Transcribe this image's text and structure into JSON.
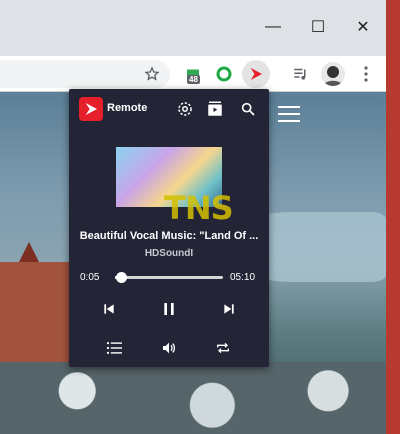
{
  "browser": {
    "window_controls": {
      "minimize": "—",
      "maximize": "☐",
      "close": "✕"
    },
    "extension_badge": "48"
  },
  "popup": {
    "app_name": "Remote",
    "track": {
      "title": "Beautiful Vocal Music: \"Land Of ...",
      "artist": "HDSoundI",
      "elapsed": "0:05",
      "duration": "05:10",
      "progress": 0.016
    },
    "watermark": "TNS"
  },
  "icons": {
    "star": "star-icon",
    "ext_green": "green-extension-icon",
    "ext_ring": "green-ring-icon",
    "ext_remote": "youtube-remote-icon",
    "queue": "queue-music-icon",
    "avatar": "avatar",
    "menu": "more-vert-icon"
  }
}
